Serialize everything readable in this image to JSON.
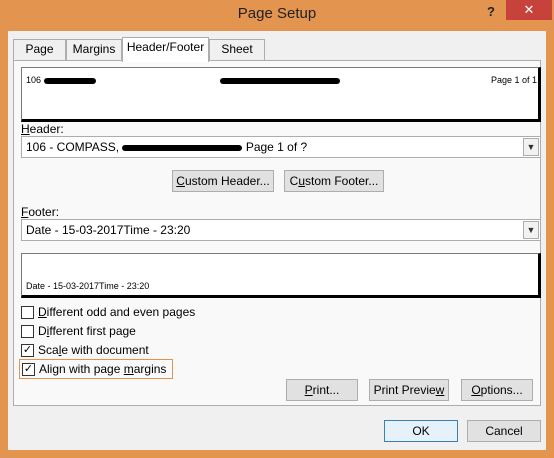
{
  "window": {
    "title": "Page Setup",
    "help_glyph": "?",
    "close_glyph": "✕"
  },
  "tabs": [
    {
      "label": "Page",
      "underline": ""
    },
    {
      "label": "Margins",
      "underline": ""
    },
    {
      "label": "Header/Footer",
      "underline": ""
    },
    {
      "label": "Sheet",
      "underline": ""
    }
  ],
  "active_tab": "Header/Footer",
  "header_preview": {
    "left": "106",
    "center": "",
    "right": "Page 1 of 1"
  },
  "header": {
    "label_pre": "H",
    "label_rest": "eader:",
    "value_pre": "106  - COMPASS, ",
    "value_post": " Page 1 of ?"
  },
  "buttons": {
    "custom_header_u": "C",
    "custom_header_rest": "ustom Header...",
    "custom_footer_pre": "C",
    "custom_footer_u": "u",
    "custom_footer_rest": "stom Footer...",
    "print_pre": "",
    "print_u": "P",
    "print_rest": "rint...",
    "print_preview_pre": "Print Previe",
    "print_preview_u": "w",
    "print_preview_rest": "",
    "options_u": "O",
    "options_rest": "ptions...",
    "ok": "OK",
    "cancel": "Cancel"
  },
  "footer": {
    "label_pre": "",
    "label_u": "F",
    "label_rest": "ooter:",
    "value": "Date - 15-03-2017Time - 23:20"
  },
  "footer_preview": {
    "left": "Date - 15-03-2017Time - 23:20"
  },
  "checkboxes": [
    {
      "u": "D",
      "rest": "ifferent odd and even pages",
      "checked": false
    },
    {
      "pre": "D",
      "u": "i",
      "rest": "fferent first page",
      "checked": false
    },
    {
      "pre": "Sca",
      "u": "l",
      "rest": "e with document",
      "checked": true
    },
    {
      "pre": "Align with page ",
      "u": "m",
      "rest": "argins",
      "checked": true
    }
  ]
}
